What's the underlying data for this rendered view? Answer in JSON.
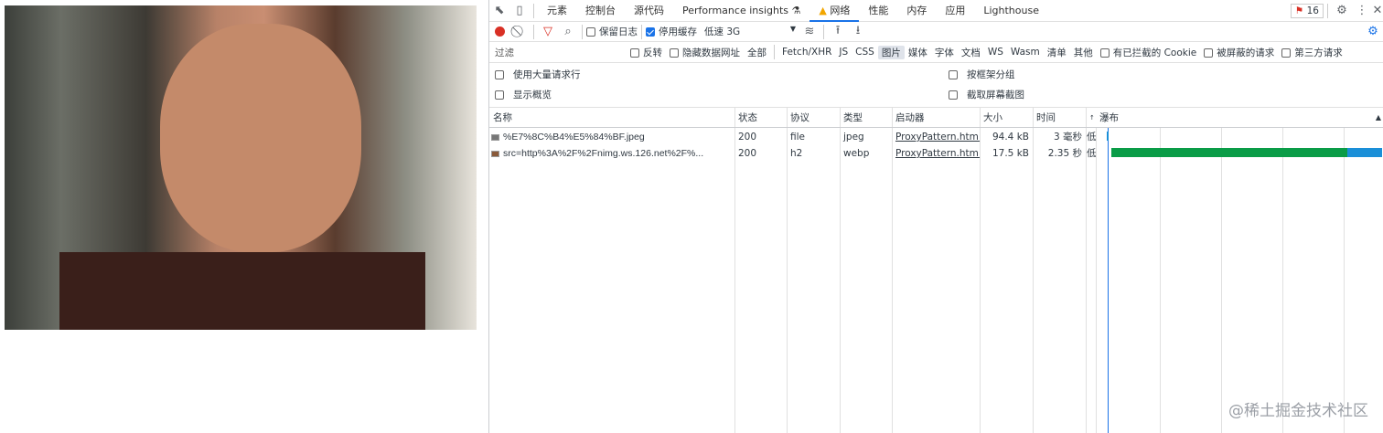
{
  "tabs": [
    "元素",
    "控制台",
    "源代码",
    "Performance insights",
    "网络",
    "性能",
    "内存",
    "应用",
    "Lighthouse"
  ],
  "active_tab": "网络",
  "issues_count": "16",
  "toolbar": {
    "preserve_log": "保留日志",
    "disable_cache": "停用缓存",
    "throttle": "低速 3G"
  },
  "filter": {
    "placeholder": "过滤",
    "invert": "反转",
    "hide_data_urls": "隐藏数据网址",
    "types": [
      "全部",
      "Fetch/XHR",
      "JS",
      "CSS",
      "图片",
      "媒体",
      "字体",
      "文档",
      "WS",
      "Wasm",
      "清单",
      "其他"
    ],
    "selected_type": "图片",
    "blocked_cookies": "有已拦截的 Cookie",
    "blocked_requests": "被屏蔽的请求",
    "third_party": "第三方请求"
  },
  "options": {
    "large_rows": "使用大量请求行",
    "group_by_frame": "按框架分组",
    "overview": "显示概览",
    "screenshots": "截取屏幕截图"
  },
  "columns": {
    "name": "名称",
    "status": "状态",
    "protocol": "协议",
    "type": "类型",
    "initiator": "启动器",
    "size": "大小",
    "time": "时间",
    "priority": "↑",
    "waterfall": "瀑布"
  },
  "rows": [
    {
      "name": "%E7%8C%B4%E5%84%BF.jpeg",
      "status": "200",
      "protocol": "file",
      "type": "jpeg",
      "initiator": "ProxyPattern.htm...",
      "size": "94.4 kB",
      "time": "3 毫秒",
      "priority": "低"
    },
    {
      "name": "src=http%3A%2F%2Fnimg.ws.126.net%2F%...",
      "status": "200",
      "protocol": "h2",
      "type": "webp",
      "initiator": "ProxyPattern.htm...",
      "size": "17.5 kB",
      "time": "2.35 秒",
      "priority": "低"
    }
  ],
  "watermark": "@稀土掘金技术社区",
  "colors": {
    "waiting": "#0a9c47",
    "download": "#1a8fd8",
    "record": "#d93025"
  }
}
